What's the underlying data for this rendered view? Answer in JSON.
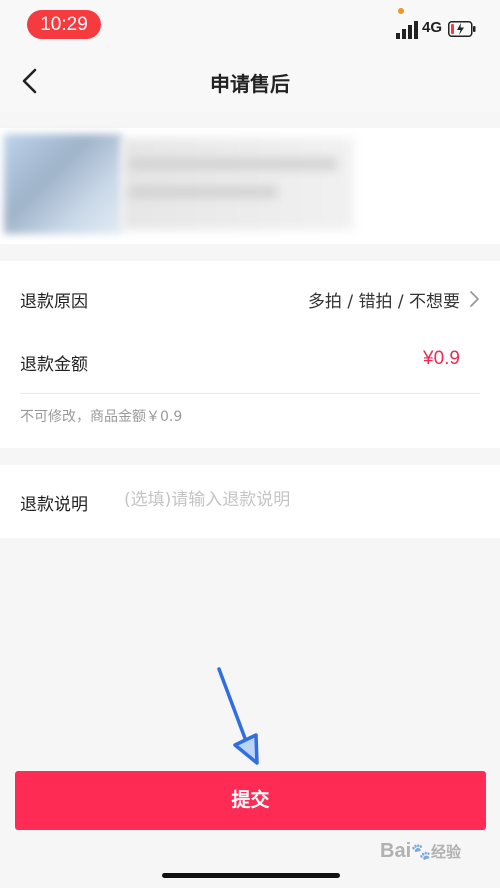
{
  "status_bar": {
    "time": "10:29",
    "network": "4G"
  },
  "nav": {
    "title": "申请售后"
  },
  "refund": {
    "reason_label": "退款原因",
    "reason_value": "多拍 / 错拍 / 不想要",
    "amount_label": "退款金额",
    "amount_value": "¥0.9",
    "hint": "不可修改，商品金额￥0.9"
  },
  "description": {
    "label": "退款说明",
    "placeholder": "(选填)请输入退款说明",
    "value": ""
  },
  "submit": {
    "label": "提交"
  },
  "colors": {
    "accent": "#fe2c55",
    "price": "#ee2a52",
    "time_pill": "#f53b40",
    "annotation_arrow": "#2f6fe0"
  },
  "icons": {
    "back": "chevron-left-icon",
    "reason_arrow": "chevron-right-icon",
    "annotation": "arrow-down-annotation"
  },
  "watermark": {
    "brand": "Bai",
    "suffix": "经验"
  }
}
